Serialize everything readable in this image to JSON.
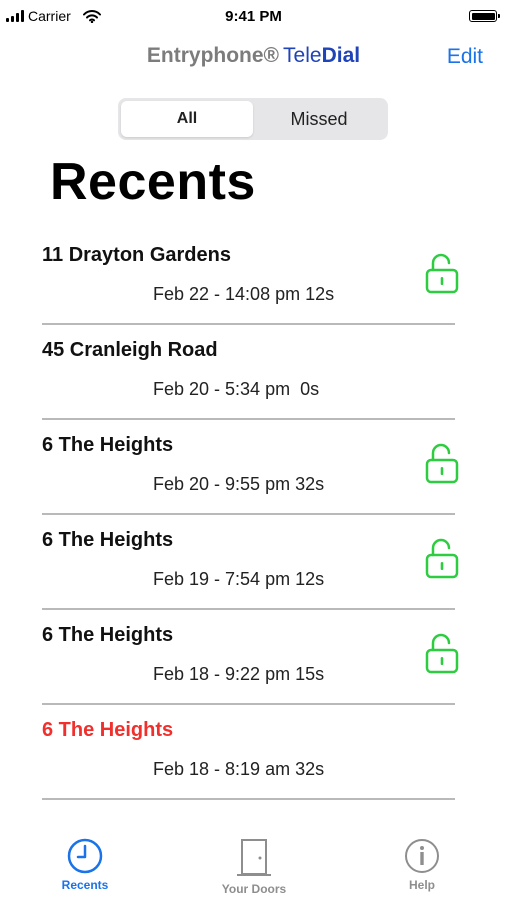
{
  "status_bar": {
    "carrier": "Carrier",
    "time": "9:41 PM"
  },
  "nav": {
    "title_part1": "Entryphone®",
    "title_part2": "Tele",
    "title_part3": "Dial",
    "edit_label": "Edit"
  },
  "segmented": {
    "options": [
      "All",
      "Missed"
    ],
    "selected": "All"
  },
  "page_title": "Recents",
  "recents": [
    {
      "name": "11 Drayton Gardens",
      "detail": "Feb 22 - 14:08 pm 12s",
      "missed": false,
      "unlocked": true
    },
    {
      "name": "45 Cranleigh Road",
      "detail": "Feb 20 - 5:34 pm  0s",
      "missed": false,
      "unlocked": false
    },
    {
      "name": "6 The Heights",
      "detail": "Feb 20 - 9:55 pm 32s",
      "missed": false,
      "unlocked": true
    },
    {
      "name": "6 The Heights",
      "detail": "Feb 19 - 7:54 pm 12s",
      "missed": false,
      "unlocked": true
    },
    {
      "name": "6 The Heights",
      "detail": "Feb 18 - 9:22 pm 15s",
      "missed": false,
      "unlocked": true
    },
    {
      "name": "6 The Heights",
      "detail": "Feb 18 - 8:19 am 32s",
      "missed": true,
      "unlocked": false
    }
  ],
  "tabs": [
    {
      "label": "Recents",
      "icon": "clock-icon",
      "active": true
    },
    {
      "label": "Your Doors",
      "icon": "door-icon",
      "active": false
    },
    {
      "label": "Help",
      "icon": "info-icon",
      "active": false
    }
  ],
  "colors": {
    "accent": "#1a73e8",
    "brand_blue": "#1f43b8",
    "brand_gray": "#7c7c7c",
    "lock_green": "#2ecc40",
    "missed_red": "#f0302c",
    "inactive_tab": "#8e8e8e"
  }
}
